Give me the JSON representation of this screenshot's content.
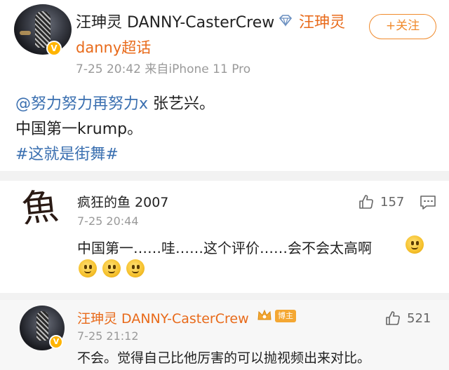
{
  "post": {
    "author": "汪珅灵 DANNY-CasterCrew",
    "author_alt": "汪珅灵",
    "supertopic": "danny超话",
    "meta": "7-25 20:42  来自iPhone 11 Pro",
    "follow_label": "+关注",
    "mention": "@努力努力再努力x",
    "line1_rest": " 张艺兴。",
    "line2": "中国第一krump。",
    "line3": "#这就是街舞#"
  },
  "comment1": {
    "avatar_char": "魚",
    "username": "疯狂的鱼 2007",
    "time": "7-25 20:44",
    "text": "中国第一……哇……这个评价……会不会太高啊",
    "likes": "157",
    "trailing_emojis": 3
  },
  "reply": {
    "username": "汪珅灵 DANNY-CasterCrew",
    "badge": "博主",
    "time": "7-25 21:12",
    "text": "不会。觉得自己比他厉害的可以抛视频出来对比。",
    "likes": "521"
  },
  "colors": {
    "accent_orange": "#e86a1a",
    "link_blue": "#3a6fb0",
    "verified_gold": "#ffb400"
  }
}
